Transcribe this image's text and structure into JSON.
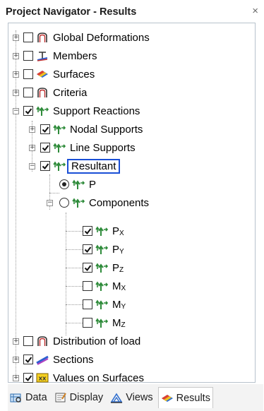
{
  "window": {
    "title": "Project Navigator - Results",
    "close": "×"
  },
  "tree": {
    "global_deformations": "Global Deformations",
    "members": "Members",
    "surfaces": "Surfaces",
    "criteria": "Criteria",
    "support_reactions": "Support Reactions",
    "nodal_supports": "Nodal Supports",
    "line_supports": "Line Supports",
    "resultant": "Resultant",
    "p": "P",
    "components": "Components",
    "px": {
      "main": "P",
      "sub": "X"
    },
    "py": {
      "main": "P",
      "sub": "Y"
    },
    "pz": {
      "main": "P",
      "sub": "Z"
    },
    "mx": {
      "main": "M",
      "sub": "X"
    },
    "my": {
      "main": "M",
      "sub": "Y"
    },
    "mz": {
      "main": "M",
      "sub": "Z"
    },
    "distribution_of_load": "Distribution of load",
    "sections": "Sections",
    "values_on_surfaces": "Values on Surfaces"
  },
  "tabs": {
    "data": "Data",
    "display": "Display",
    "views": "Views",
    "results": "Results"
  },
  "colors": {
    "highlight": "#1a4fd6",
    "support_green": "#2e8b3a"
  }
}
